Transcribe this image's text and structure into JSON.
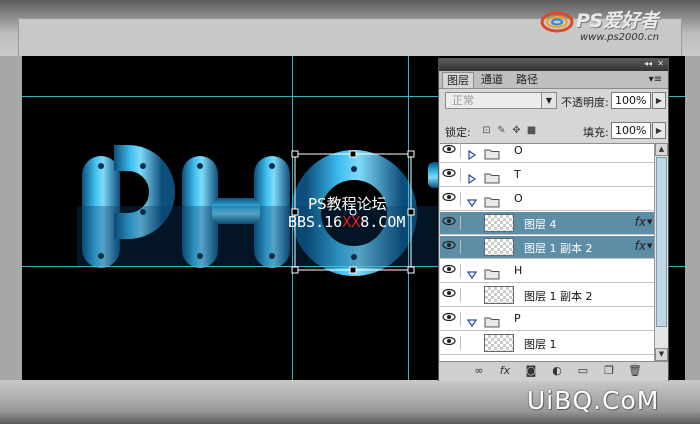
{
  "brand": {
    "name": "PS爱好者",
    "url": "www.ps2000.cn"
  },
  "canvas": {
    "watermark_line1": "PS教程论坛",
    "watermark_line2_prefix": "BBS.16",
    "watermark_line2_red": "XX",
    "watermark_line2_suffix": "8.COM"
  },
  "site_watermark": "UiBQ.CoM",
  "layers_panel": {
    "tabs": [
      "图层",
      "通道",
      "路径"
    ],
    "menu_icon": "panel-menu-icon",
    "blend_mode": "正常",
    "opacity_label": "不透明度:",
    "opacity_value": "100%",
    "lock_label": "锁定:",
    "fill_label": "填充:",
    "fill_value": "100%",
    "layers": [
      {
        "type": "group",
        "name": "O",
        "expanded": false,
        "selected": false
      },
      {
        "type": "group",
        "name": "T",
        "expanded": false,
        "selected": false
      },
      {
        "type": "group",
        "name": "O",
        "expanded": true,
        "selected": false
      },
      {
        "type": "layer",
        "name": "图层 4",
        "fx": "fx",
        "selected": true
      },
      {
        "type": "layer",
        "name": "图层 1 副本 2",
        "fx": "fx",
        "selected": true
      },
      {
        "type": "group",
        "name": "H",
        "expanded": true,
        "selected": false
      },
      {
        "type": "layer",
        "name": "图层 1 副本 2",
        "fx": "",
        "selected": false
      },
      {
        "type": "group",
        "name": "P",
        "expanded": true,
        "selected": false
      },
      {
        "type": "layer",
        "name": "图层 1",
        "fx": "",
        "selected": false
      }
    ],
    "bottom_icons": [
      "link-icon",
      "fx-icon",
      "mask-icon",
      "adjustment-icon",
      "new-group-icon",
      "new-layer-icon",
      "trash-icon"
    ]
  },
  "colors": {
    "selection": "#5d8ea6",
    "letter_blue": "#2a9fd8",
    "guide": "#3ec6d6"
  }
}
